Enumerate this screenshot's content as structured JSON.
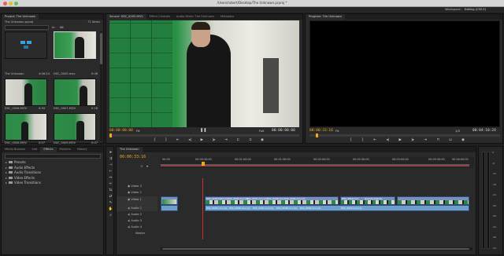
{
  "window": {
    "title": "/Users/robert/Desktop/The Unknown.prproj *",
    "workspace_label": "Workspace:",
    "workspace_value": "Editing (CS5.5)"
  },
  "project_panel": {
    "tab": "Project: The Unknown",
    "item_count": "71 Items",
    "file_name": "The Unknown.prproj",
    "in_label": "In:",
    "in_value": "All",
    "items": [
      {
        "name": "The Unknown",
        "duration": "4:06:24"
      },
      {
        "name": "DSC_0005.mov",
        "duration": "0:08"
      },
      {
        "name": "DSC_0006.MOV",
        "duration": "0:33"
      },
      {
        "name": "DSC_0007.MOV",
        "duration": "0:18"
      },
      {
        "name": "DSC_0008.MOV",
        "duration": "0:07"
      },
      {
        "name": "DSC_0009.MOV",
        "duration": "0:07"
      }
    ]
  },
  "source_monitor": {
    "tabs": [
      "Source: DSC_0005.MOV",
      "Effect Controls",
      "Audio Mixer: The Unknown",
      "Metadata"
    ],
    "timecode_in": "00:00:00:00",
    "fit": "Fit",
    "timecode_dur": "00:00:08:00",
    "zoom": "Full"
  },
  "program_monitor": {
    "tab": "Program: The Unknown",
    "timecode_in": "00:00:33:16",
    "fit": "Fit",
    "resolution": "1/2",
    "timecode_dur": "00:04:10:24"
  },
  "effects_panel": {
    "tabs": [
      "Media Browser",
      "Info",
      "Effects",
      "Markers",
      "History"
    ],
    "items": [
      "Presets",
      "Audio Effects",
      "Audio Transitions",
      "Video Effects",
      "Video Transitions"
    ]
  },
  "timeline": {
    "tab": "The Unknown",
    "timecode": "00:00:33:16",
    "ruler": [
      "00:00",
      "00:00:30:00",
      "00:01:00:00",
      "00:01:30:00",
      "00:02:00:00",
      "00:02:30:00",
      "00:03:00:00",
      "00:03:30:00",
      "00:04:00:00"
    ],
    "tracks": [
      {
        "label": "Video 3"
      },
      {
        "label": "Video 2"
      },
      {
        "label": "Video 1"
      },
      {
        "label": "Audio 1"
      },
      {
        "label": "Audio 2"
      },
      {
        "label": "Audio 3"
      },
      {
        "label": "Audio 4"
      },
      {
        "label": "Master"
      }
    ],
    "clip_labels": [
      "DSC_0005.MOV [V]",
      "DSC_0006.mov [V]",
      "DSC_0007.mov [V]",
      "DSC_0008.mov",
      "DSC_0009.mov [V]",
      "DSC_0016.mov",
      "Opacity:Opacity"
    ],
    "audio_clip_labels": [
      "DSC_0005.mov [A]",
      "DSC_0006.mov [A]",
      "DSC_0007.mov [A]",
      "DSC_0008.mov [A]",
      "DSC_0009.mov [A]",
      "DSC_0016.mov [A]"
    ]
  },
  "meter": {
    "labels": [
      "0",
      "-6",
      "-12",
      "-18",
      "-24",
      "-30",
      "-36",
      "-42",
      "-48",
      "-54"
    ]
  },
  "colors": {
    "accent_timecode": "#f0a81a",
    "video_clip": "#7890c0",
    "audio_clip": "#6f9ec9",
    "playhead": "#d03030"
  }
}
